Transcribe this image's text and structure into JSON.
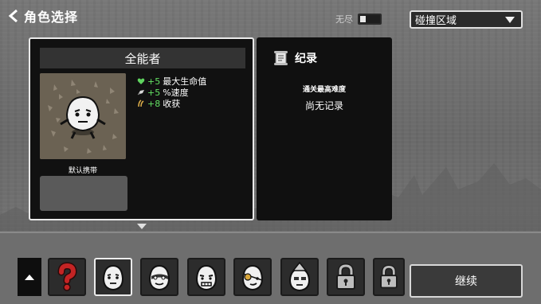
{
  "header": {
    "title": "角色选择"
  },
  "endless": {
    "label": "无尽",
    "enabled": false
  },
  "zone_select": {
    "selected": "碰撞区域"
  },
  "character": {
    "name": "全能者",
    "stats": [
      {
        "value": "+5",
        "label": "最大生命值",
        "icon": "heart-icon"
      },
      {
        "value": "+5",
        "label": "%速度",
        "icon": "speed-icon"
      },
      {
        "value": "+8",
        "label": "收获",
        "icon": "harvest-icon"
      }
    ],
    "default_item_label": "默认携带"
  },
  "record": {
    "title": "纪录",
    "subtitle": "通关最高难度",
    "value": "尚无记录"
  },
  "roster": [
    {
      "id": "random",
      "icon": "question-mark-icon",
      "locked": false,
      "selected": false
    },
    {
      "id": "well-rounded",
      "icon": "potato-icon",
      "locked": false,
      "selected": true
    },
    {
      "id": "brawler",
      "icon": "potato-mask-icon",
      "locked": false,
      "selected": false
    },
    {
      "id": "crazy",
      "icon": "potato-grin-icon",
      "locked": false,
      "selected": false
    },
    {
      "id": "ranger",
      "icon": "potato-eyepatch-icon",
      "locked": false,
      "selected": false
    },
    {
      "id": "mage",
      "icon": "potato-hat-icon",
      "locked": false,
      "selected": false
    },
    {
      "id": "locked-1",
      "icon": "lock-icon",
      "locked": true,
      "selected": false
    },
    {
      "id": "locked-2",
      "icon": "lock-icon",
      "locked": true,
      "selected": false
    }
  ],
  "continue_label": "继续",
  "colors": {
    "stat_value": "#63e263",
    "panel_bg": "#111111",
    "selected_border": "#ececec"
  }
}
